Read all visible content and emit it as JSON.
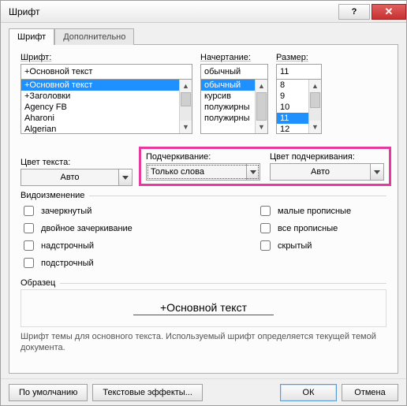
{
  "title": "Шрифт",
  "tabs": {
    "font": "Шрифт",
    "advanced": "Дополнительно"
  },
  "labels": {
    "font": "Шрифт:",
    "style": "Начертание:",
    "size": "Размер:",
    "textColor": "Цвет текста:",
    "underlineStyle": "Подчеркивание:",
    "underlineColor": "Цвет подчеркивания:",
    "effects": "Видоизменение",
    "sample": "Образец"
  },
  "font": {
    "value": "+Основной текст",
    "list": [
      "+Основной текст",
      "+Заголовки",
      "Agency FB",
      "Aharoni",
      "Algerian"
    ],
    "selectedIndex": 0
  },
  "style": {
    "value": "обычный",
    "list": [
      "обычный",
      "курсив",
      "полужирны",
      "полужирны"
    ],
    "selectedIndex": 0
  },
  "size": {
    "value": "11",
    "list": [
      "8",
      "9",
      "10",
      "11",
      "12"
    ],
    "selectedIndex": 3
  },
  "textColor": {
    "value": "Авто"
  },
  "underlineStyle": {
    "value": "Только слова"
  },
  "underlineColor": {
    "value": "Авто"
  },
  "effects": {
    "strike": "зачеркнутый",
    "dstrike": "двойное зачеркивание",
    "superscript": "надстрочный",
    "subscript": "подстрочный",
    "smallcaps": "малые прописные",
    "allcaps": "все прописные",
    "hidden": "скрытый"
  },
  "sampleText": "+Основной текст",
  "footnote": "Шрифт темы для основного текста. Используемый шрифт определяется текущей темой документа.",
  "buttons": {
    "defaults": "По умолчанию",
    "textEffects": "Текстовые эффекты...",
    "ok": "ОК",
    "cancel": "Отмена"
  }
}
